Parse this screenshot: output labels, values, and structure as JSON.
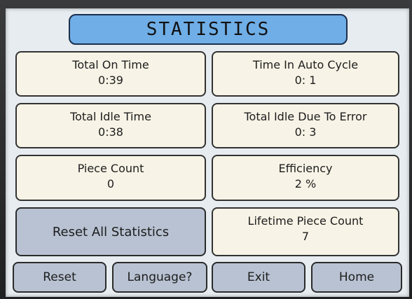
{
  "title": "STATISTICS",
  "stats": {
    "total_on_time": {
      "label": "Total On Time",
      "value": "0:39"
    },
    "time_in_auto_cycle": {
      "label": "Time In Auto Cycle",
      "value": "0: 1"
    },
    "total_idle_time": {
      "label": "Total Idle Time",
      "value": "0:38"
    },
    "total_idle_due_to_error": {
      "label": "Total Idle Due To Error",
      "value": "0: 3"
    },
    "piece_count": {
      "label": "Piece Count",
      "value": "0"
    },
    "efficiency": {
      "label": "Efficiency",
      "value": "2 %"
    },
    "lifetime_piece_count": {
      "label": "Lifetime Piece Count",
      "value": "7"
    }
  },
  "buttons": {
    "reset_all_statistics": "Reset All Statistics",
    "reset": "Reset",
    "language": "Language?",
    "exit": "Exit",
    "home": "Home"
  },
  "colors": {
    "title_bg": "#6faee6",
    "card_bg": "#f7f3e6",
    "button_bg": "#b8c2d2",
    "screen_bg": "#e6ecef"
  }
}
